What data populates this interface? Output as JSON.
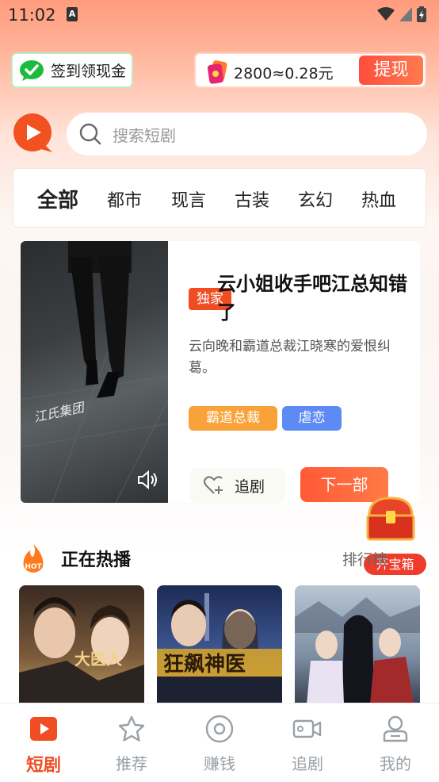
{
  "status_bar": {
    "time": "11:02"
  },
  "checkin": {
    "label": "签到领现金"
  },
  "wallet": {
    "coins": "2800≈0.28元",
    "withdraw": "提现"
  },
  "search": {
    "placeholder": "搜索短剧"
  },
  "categories": [
    "全部",
    "都市",
    "现言",
    "古装",
    "玄幻",
    "热血"
  ],
  "featured": {
    "badge": "独家",
    "title": "云小姐收手吧江总知错了",
    "description": "云向晚和霸道总裁江晓寒的爱恨纠葛。",
    "tags": [
      "霸道总裁",
      "虐恋"
    ],
    "follow": "追剧",
    "next": "下一部",
    "poster_caption": "江氏集团"
  },
  "chest": {
    "label": "开宝箱"
  },
  "hot": {
    "badge": "HOT",
    "title": "正在热播",
    "rank_link": "排行榜"
  },
  "thumbnails": [
    {
      "title": "大医人"
    },
    {
      "title": "狂飙神医"
    },
    {
      "title": ""
    }
  ],
  "tabs": [
    {
      "label": "短剧",
      "icon": "play-icon"
    },
    {
      "label": "推荐",
      "icon": "star-icon"
    },
    {
      "label": "赚钱",
      "icon": "coin-circle-icon"
    },
    {
      "label": "追剧",
      "icon": "video-camera-icon"
    },
    {
      "label": "我的",
      "icon": "user-icon"
    }
  ],
  "colors": {
    "accent": "#f04d23",
    "withdraw_bg": "#ff5a3c",
    "tag_orange": "#f9a23a",
    "tag_blue": "#5d8af4"
  }
}
